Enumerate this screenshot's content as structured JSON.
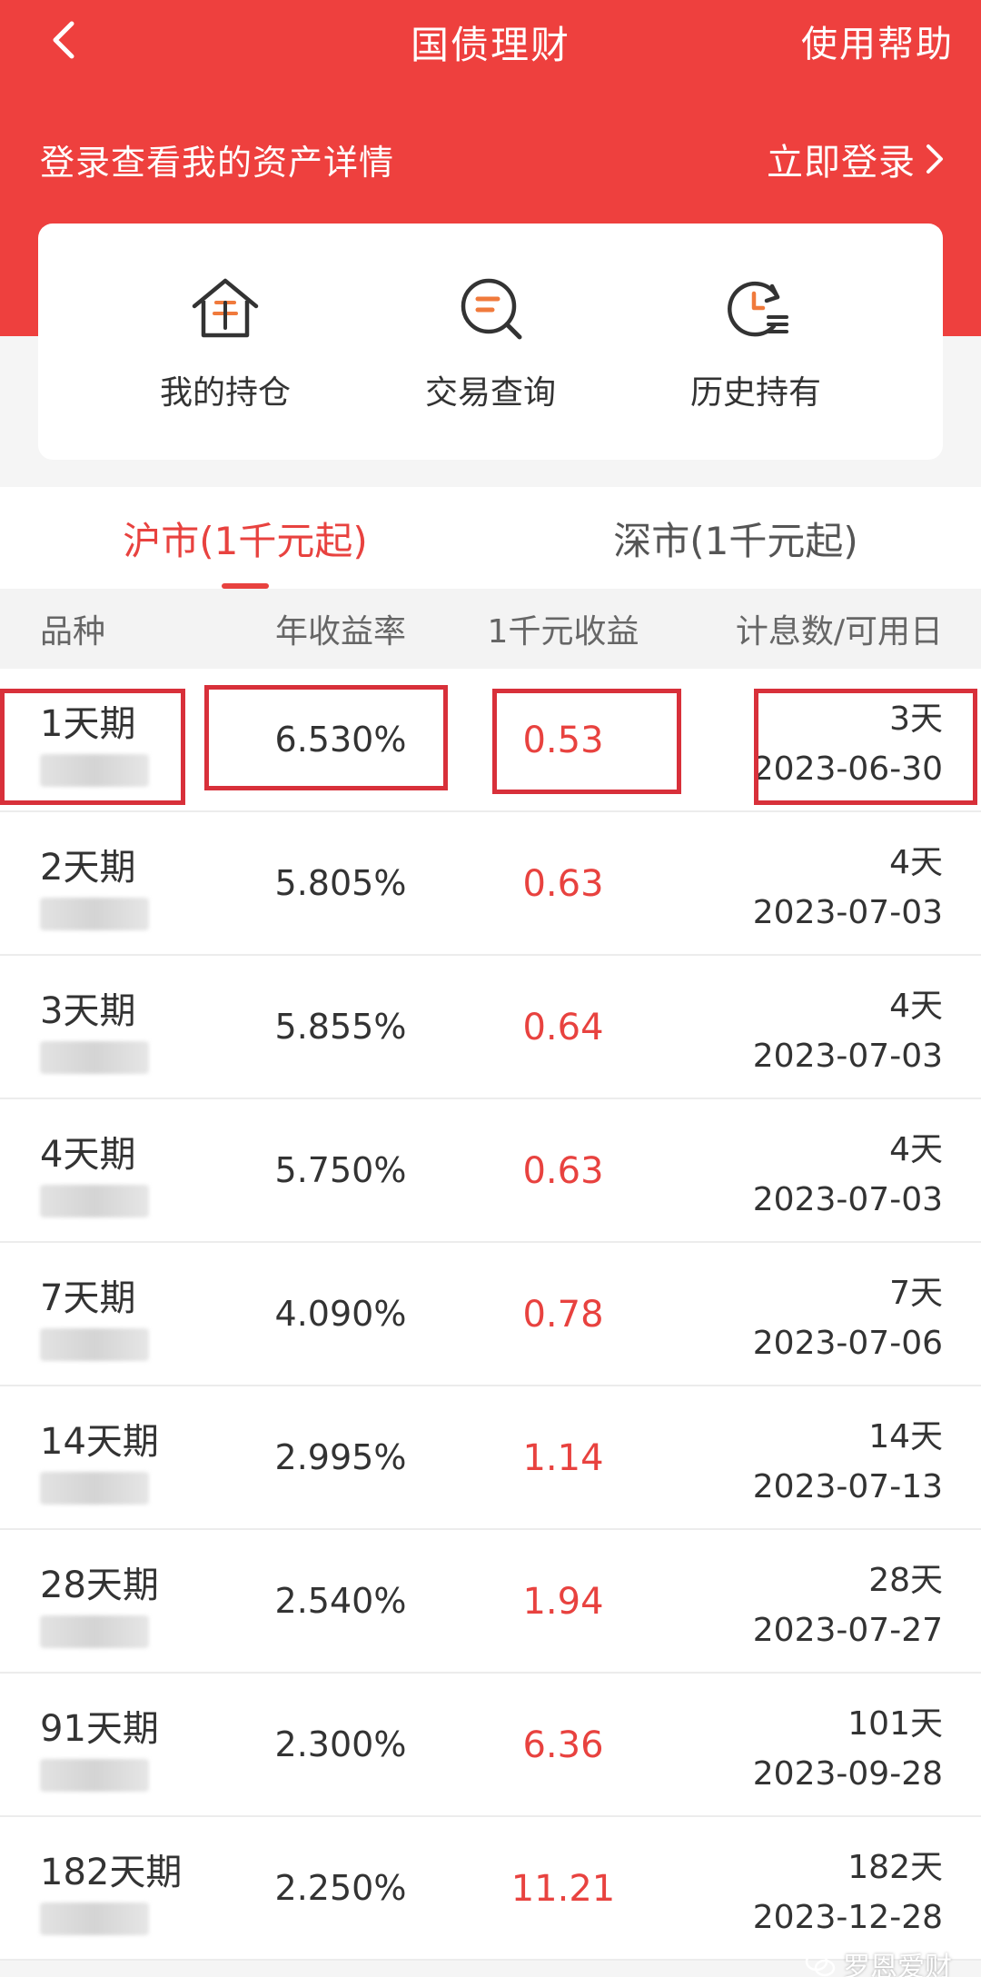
{
  "navbar": {
    "title": "国债理财",
    "help_label": "使用帮助"
  },
  "login": {
    "prompt": "登录查看我的资产详情",
    "button_label": "立即登录"
  },
  "shortcuts": [
    {
      "label": "我的持仓",
      "icon": "house-yuan-icon"
    },
    {
      "label": "交易查询",
      "icon": "search-list-icon"
    },
    {
      "label": "历史持有",
      "icon": "history-clock-icon"
    }
  ],
  "tabs": [
    {
      "label": "沪市(1千元起)",
      "active": true
    },
    {
      "label": "深市(1千元起)",
      "active": false
    }
  ],
  "table": {
    "headers": [
      "品种",
      "年收益率",
      "1千元收益",
      "计息数/可用日"
    ],
    "rows": [
      {
        "name": "1天期",
        "rate": "6.530%",
        "income": "0.53",
        "days": "3天",
        "date": "2023-06-30"
      },
      {
        "name": "2天期",
        "rate": "5.805%",
        "income": "0.63",
        "days": "4天",
        "date": "2023-07-03"
      },
      {
        "name": "3天期",
        "rate": "5.855%",
        "income": "0.64",
        "days": "4天",
        "date": "2023-07-03"
      },
      {
        "name": "4天期",
        "rate": "5.750%",
        "income": "0.63",
        "days": "4天",
        "date": "2023-07-03"
      },
      {
        "name": "7天期",
        "rate": "4.090%",
        "income": "0.78",
        "days": "7天",
        "date": "2023-07-06"
      },
      {
        "name": "14天期",
        "rate": "2.995%",
        "income": "1.14",
        "days": "14天",
        "date": "2023-07-13"
      },
      {
        "name": "28天期",
        "rate": "2.540%",
        "income": "1.94",
        "days": "28天",
        "date": "2023-07-27"
      },
      {
        "name": "91天期",
        "rate": "2.300%",
        "income": "6.36",
        "days": "101天",
        "date": "2023-09-28"
      },
      {
        "name": "182天期",
        "rate": "2.250%",
        "income": "11.21",
        "days": "182天",
        "date": "2023-12-28"
      }
    ]
  },
  "watermark": {
    "text": "罗恩爱财"
  },
  "colors": {
    "brand_red": "#ee403e",
    "income_red": "#e8423f",
    "highlight_red": "#d8303a"
  }
}
